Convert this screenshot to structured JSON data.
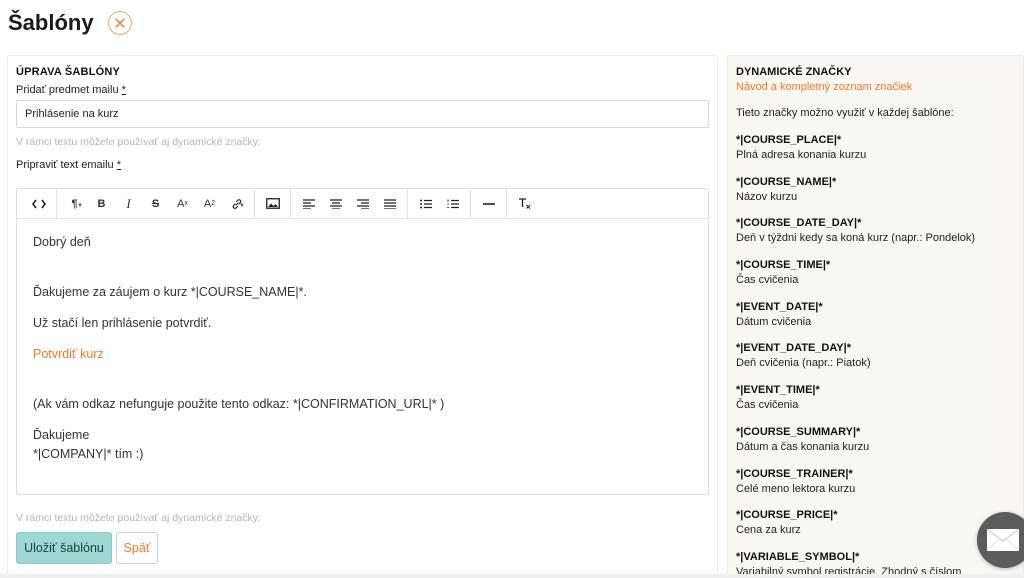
{
  "page": {
    "title": "Šablóny"
  },
  "form": {
    "section_title": "ÚPRAVA ŠABLÓNY",
    "subject_label": "Pridať predmet mailu",
    "subject_required": "*",
    "subject_value": "Prihlásenie na kurz",
    "hint_top": "V rámci textu môžete používať aj dynamické značky.",
    "body_label": "Pripraviť text emailu",
    "body_required": "*",
    "hint_bottom": "V rámci textu môžete používať aj dynamické značky.",
    "save_label": "Uložiť šablónu",
    "back_label": "Späť"
  },
  "toolbar": {
    "paragraph": "¶",
    "bold": "B",
    "italic": "I",
    "strike": "S",
    "superscript": "A",
    "subscript": "A"
  },
  "editor": {
    "line1": "Dobrý deň",
    "line2": "Ďakujeme za záujem o kurz *|COURSE_NAME|*.",
    "line3": "Už stačí len prihlásenie potvrdiť.",
    "link": "Potvrdiť kurz",
    "line4": "(Ak vám odkaz nefunguje použite tento odkaz: *|CONFIRMATION_URL|* )",
    "line5": "Ďakujeme",
    "line6": "*|COMPANY|* tím :)"
  },
  "tags_panel": {
    "title": "DYNAMICKÉ ZNAČKY",
    "link": "Návod a kompletný zoznam značiek",
    "intro": "Tieto značky možno využiť v každej šablóne:",
    "tags": [
      {
        "code": "*|COURSE_PLACE|*",
        "desc": "Plná adresa konania kurzu"
      },
      {
        "code": "*|COURSE_NAME|*",
        "desc": "Názov kurzu"
      },
      {
        "code": "*|COURSE_DATE_DAY|*",
        "desc": "Deň v týždni kedy sa koná kurz (napr.: Pondelok)"
      },
      {
        "code": "*|COURSE_TIME|*",
        "desc": "Čas cvičenia"
      },
      {
        "code": "*|EVENT_DATE|*",
        "desc": "Dátum cvičenia"
      },
      {
        "code": "*|EVENT_DATE_DAY|*",
        "desc": "Deň cvičenia (napr.: Piatok)"
      },
      {
        "code": "*|EVENT_TIME|*",
        "desc": "Čas cvičenia"
      },
      {
        "code": "*|COURSE_SUMMARY|*",
        "desc": "Dátum a čas konania kurzu"
      },
      {
        "code": "*|COURSE_TRAINER|*",
        "desc": "Celé meno lektora kurzu"
      },
      {
        "code": "*|COURSE_PRICE|*",
        "desc": "Cena za kurz"
      },
      {
        "code": "*|VARIABLE_SYMBOL|*",
        "desc": "Variabilný symbol registrácie. Zhodný s číslom"
      }
    ]
  },
  "colors": {
    "accent_orange": "#f07a28",
    "save_button": "#9fd7d4",
    "panel_bg": "#faf7f2"
  }
}
